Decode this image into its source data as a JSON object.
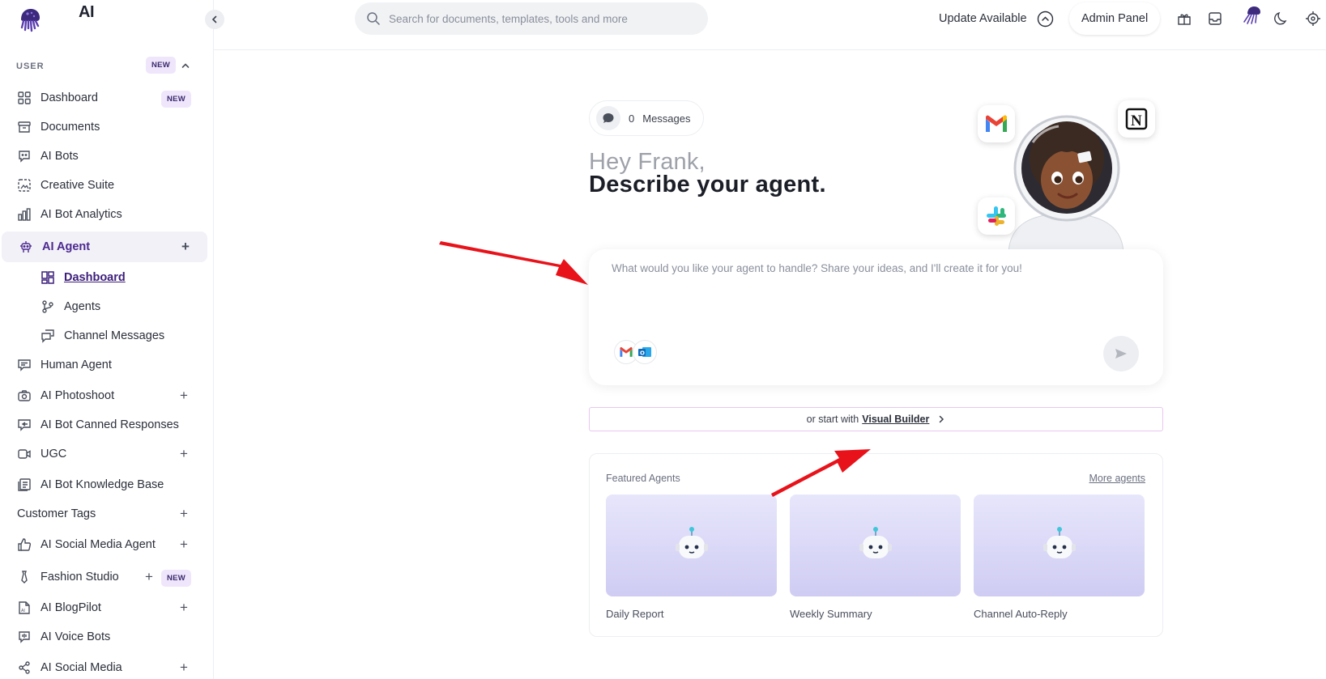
{
  "app": {
    "name": "AI"
  },
  "sidebar": {
    "section_label": "USER",
    "section_badge": "NEW",
    "items": [
      {
        "label": "Dashboard",
        "icon": "grid-icon",
        "badge": "NEW"
      },
      {
        "label": "Documents",
        "icon": "archive-icon"
      },
      {
        "label": "AI Bots",
        "icon": "chat-bot-icon"
      },
      {
        "label": "Creative Suite",
        "icon": "image-frame-icon"
      },
      {
        "label": "AI Bot Analytics",
        "icon": "bar-chart-icon"
      },
      {
        "label": "AI Agent",
        "icon": "robot-icon",
        "expand": "+"
      },
      {
        "label": "Dashboard",
        "icon": "dashboard-icon"
      },
      {
        "label": "Agents",
        "icon": "branch-icon"
      },
      {
        "label": "Channel Messages",
        "icon": "messages-icon"
      },
      {
        "label": "Human Agent",
        "icon": "message-square-icon"
      },
      {
        "label": "AI Photoshoot",
        "icon": "camera-icon",
        "expand": "+"
      },
      {
        "label": "AI Bot Canned Responses",
        "icon": "reply-icon"
      },
      {
        "label": "UGC",
        "icon": "video-icon",
        "expand": "+"
      },
      {
        "label": "AI Bot Knowledge Base",
        "icon": "book-icon"
      },
      {
        "label": "Customer Tags",
        "expand": "+"
      },
      {
        "label": "AI Social Media Agent",
        "icon": "thumbs-up-icon",
        "expand": "+"
      },
      {
        "label": "Fashion Studio",
        "icon": "tie-icon",
        "expand": "+",
        "badge": "NEW"
      },
      {
        "label": "AI BlogPilot",
        "icon": "blog-doc-icon",
        "expand": "+"
      },
      {
        "label": "AI Voice Bots",
        "icon": "voice-bot-icon"
      },
      {
        "label": "AI Social Media",
        "icon": "share-icon",
        "expand": "+"
      }
    ]
  },
  "topbar": {
    "search_placeholder": "Search for documents, templates, tools and more",
    "update_label": "Update Available",
    "admin_label": "Admin Panel"
  },
  "main": {
    "messages_count": "0",
    "messages_label": "Messages",
    "greeting": "Hey Frank,",
    "headline": "Describe your agent.",
    "composer_placeholder": "What would you like your agent to handle? Share your ideas, and I'll create it for you!",
    "vb_prefix": "or start with",
    "vb_link": "Visual Builder",
    "featured_title": "Featured Agents",
    "featured_more": "More agents",
    "featured_agents": [
      {
        "name": "Daily Report"
      },
      {
        "name": "Weekly Summary"
      },
      {
        "name": "Channel Auto-Reply"
      }
    ]
  },
  "colors": {
    "accent": "#4b2a8f",
    "active_bg": "#f3f1f8",
    "badge_bg": "#efe6fb",
    "arrow": "#e8121a",
    "card_gradient_top": "#e7e6fb",
    "card_gradient_bottom": "#cfccf3"
  }
}
